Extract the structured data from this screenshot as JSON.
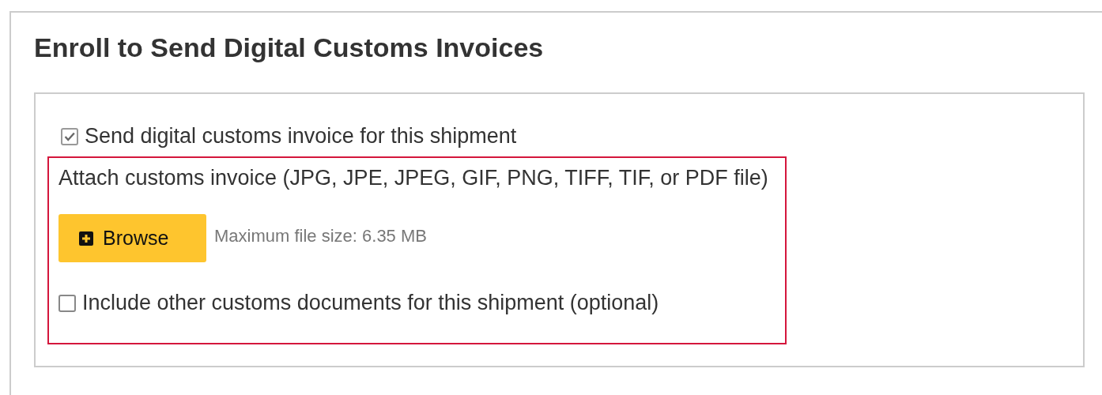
{
  "panel": {
    "title": "Enroll to Send Digital Customs Invoices"
  },
  "send_invoice": {
    "label": "Send digital customs invoice for this shipment",
    "checked": true
  },
  "attach": {
    "label": "Attach customs invoice (JPG, JPE, JPEG, GIF, PNG, TIFF, TIF, or PDF file)",
    "button": "Browse",
    "hint": "Maximum file size: 6.35 MB"
  },
  "include_other": {
    "label": "Include other customs documents for this shipment (optional)",
    "checked": false
  }
}
